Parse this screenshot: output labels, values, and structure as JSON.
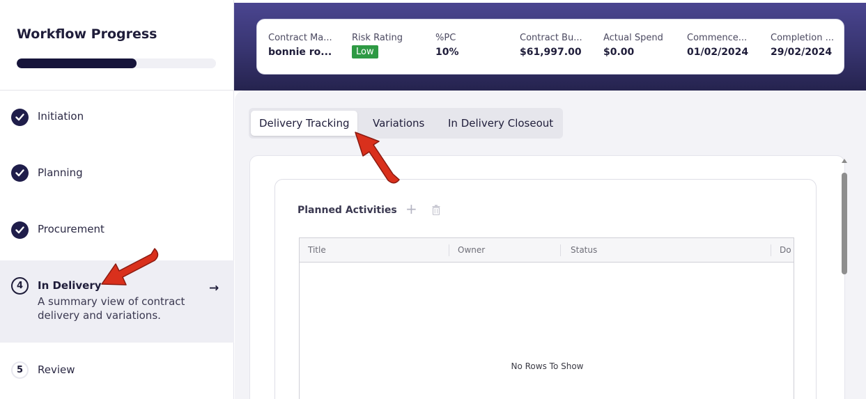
{
  "workflow": {
    "title": "Workflow Progress",
    "progress": 0.6
  },
  "steps": [
    {
      "label": "Initiation",
      "state": "complete",
      "icon": "check-icon"
    },
    {
      "label": "Planning",
      "state": "complete",
      "icon": "check-icon"
    },
    {
      "label": "Procurement",
      "state": "complete",
      "icon": "check-icon"
    },
    {
      "number": "4",
      "label": "In Delivery",
      "state": "active",
      "description": "A summary view of contract delivery and variations.",
      "arrow": "→"
    },
    {
      "number": "5",
      "label": "Review",
      "state": "pending"
    }
  ],
  "summary": {
    "contract_manager": {
      "label": "Contract Ma...",
      "value": "bonnie ro..."
    },
    "risk_rating": {
      "label": "Risk Rating",
      "value": "Low",
      "color": "#2e9a44"
    },
    "pc": {
      "label": "%PC",
      "value": "10%"
    },
    "contract_budget": {
      "label": "Contract Bu...",
      "value": "$61,997.00"
    },
    "actual_spend": {
      "label": "Actual Spend",
      "value": "$0.00"
    },
    "commencement": {
      "label": "Commence...",
      "value": "01/02/2024"
    },
    "completion": {
      "label": "Completion ...",
      "value": "29/02/2024"
    }
  },
  "tabs": [
    {
      "label": "Delivery Tracking",
      "active": true
    },
    {
      "label": "Variations",
      "active": false
    },
    {
      "label": "In Delivery Closeout",
      "active": false
    }
  ],
  "planned_activities": {
    "title": "Planned Activities",
    "add_icon": "plus-icon",
    "delete_icon": "trash-icon",
    "columns": [
      "Title",
      "Owner",
      "Status",
      "Do"
    ],
    "empty_message": "No Rows To Show"
  },
  "colors": {
    "banner": "#37346f",
    "navy": "#1f1d4a",
    "annotation_arrow": "#d9301c"
  }
}
